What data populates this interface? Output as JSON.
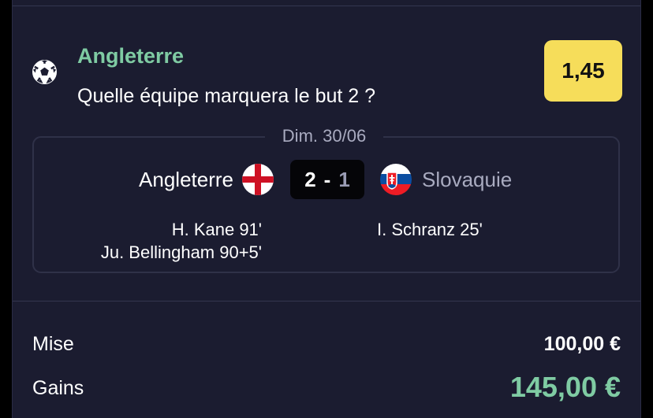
{
  "bet": {
    "team": "Angleterre",
    "question": "Quelle équipe marquera le but 2 ?",
    "odds": "1,45",
    "sport_icon": "soccer-ball-icon"
  },
  "match": {
    "date": "Dim. 30/06",
    "home_team": "Angleterre",
    "away_team": "Slovaquie",
    "home_score": "2",
    "separator": "-",
    "away_score": "1",
    "home_scorers": [
      "H. Kane 91'",
      "Ju. Bellingham 90+5'"
    ],
    "away_scorers": [
      "I. Schranz 25'"
    ],
    "home_flag": "england-flag-icon",
    "away_flag": "slovakia-flag-icon"
  },
  "summary": {
    "stake_label": "Mise",
    "stake_value": "100,00 €",
    "winnings_label": "Gains",
    "winnings_value": "145,00 €"
  },
  "colors": {
    "accent_green": "#7fcba3",
    "odds_yellow": "#f6dd5a",
    "card_bg": "#1b1c30"
  }
}
